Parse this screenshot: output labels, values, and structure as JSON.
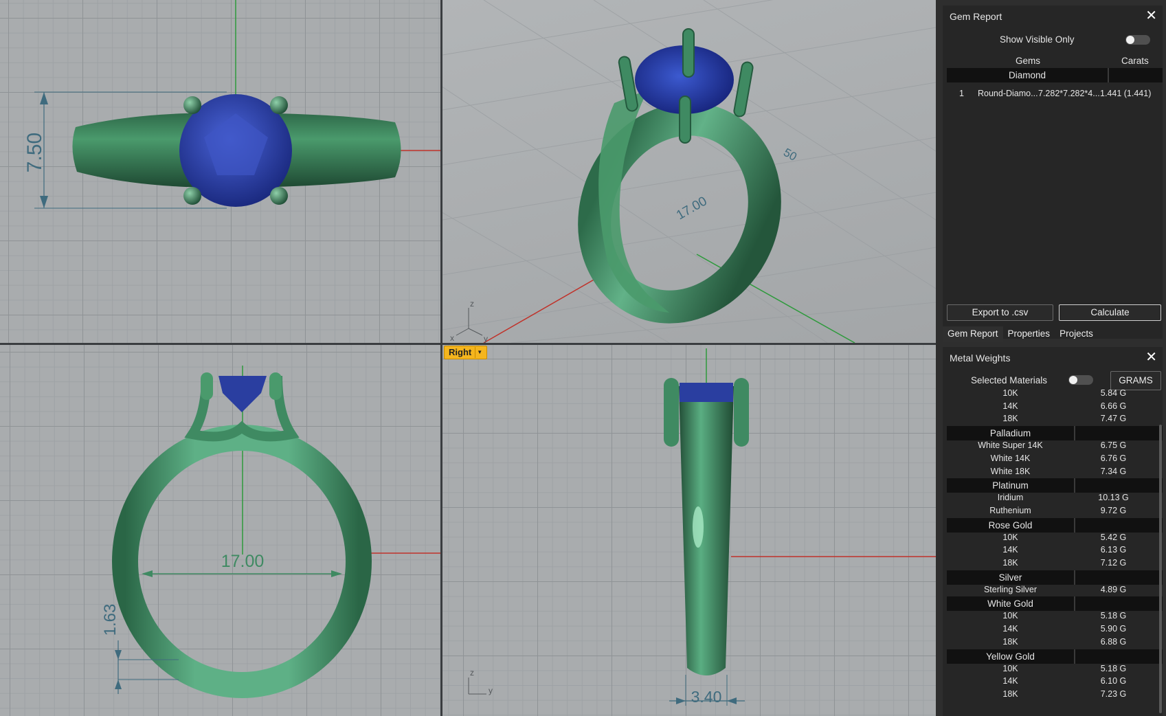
{
  "viewports": {
    "right_label": "Right",
    "dimensions": {
      "top_width": "7.50",
      "persp_ring": "17.00",
      "persp_partial": "50",
      "front_diameter": "17.00",
      "front_thickness": "1.63",
      "right_width": "3.40"
    },
    "axes": {
      "z": "z",
      "x": "x",
      "y": "y"
    },
    "colors": {
      "metal": "#3f8a62",
      "gem": "#2a3ea0",
      "x_axis": "#c0322a",
      "y_axis": "#2e9a3c",
      "dim": "#3f6b7e"
    }
  },
  "gem_report": {
    "title": "Gem Report",
    "show_visible_only": "Show Visible Only",
    "col_gems": "Gems",
    "col_carats": "Carats",
    "category": "Diamond",
    "rows": [
      {
        "index": "1",
        "name": "Round-Diamo...",
        "size": "7.282*7.282*4...",
        "carats": "1.441 (1.441)"
      }
    ],
    "export_button": "Export to .csv",
    "calculate_button": "Calculate"
  },
  "tabs": [
    "Gem Report",
    "Properties",
    "Projects"
  ],
  "metal_weights": {
    "title": "Metal Weights",
    "selected_materials": "Selected Materials",
    "units_button": "GRAMS",
    "partial_rows": [
      {
        "name": "10K",
        "value": "5.84 G"
      },
      {
        "name": "14K",
        "value": "6.66 G"
      },
      {
        "name": "18K",
        "value": "7.47 G"
      }
    ],
    "groups": [
      {
        "name": "Palladium",
        "items": [
          {
            "name": "White Super 14K",
            "value": "6.75 G"
          },
          {
            "name": "White 14K",
            "value": "6.76 G"
          },
          {
            "name": "White 18K",
            "value": "7.34 G"
          }
        ]
      },
      {
        "name": "Platinum",
        "items": [
          {
            "name": "Iridium",
            "value": "10.13 G"
          },
          {
            "name": "Ruthenium",
            "value": "9.72 G"
          }
        ]
      },
      {
        "name": "Rose Gold",
        "items": [
          {
            "name": "10K",
            "value": "5.42 G"
          },
          {
            "name": "14K",
            "value": "6.13 G"
          },
          {
            "name": "18K",
            "value": "7.12 G"
          }
        ]
      },
      {
        "name": "Silver",
        "items": [
          {
            "name": "Sterling Silver",
            "value": "4.89 G"
          }
        ]
      },
      {
        "name": "White Gold",
        "items": [
          {
            "name": "10K",
            "value": "5.18 G"
          },
          {
            "name": "14K",
            "value": "5.90 G"
          },
          {
            "name": "18K",
            "value": "6.88 G"
          }
        ]
      },
      {
        "name": "Yellow Gold",
        "items": [
          {
            "name": "10K",
            "value": "5.18 G"
          },
          {
            "name": "14K",
            "value": "6.10 G"
          },
          {
            "name": "18K",
            "value": "7.23 G"
          }
        ]
      }
    ]
  }
}
